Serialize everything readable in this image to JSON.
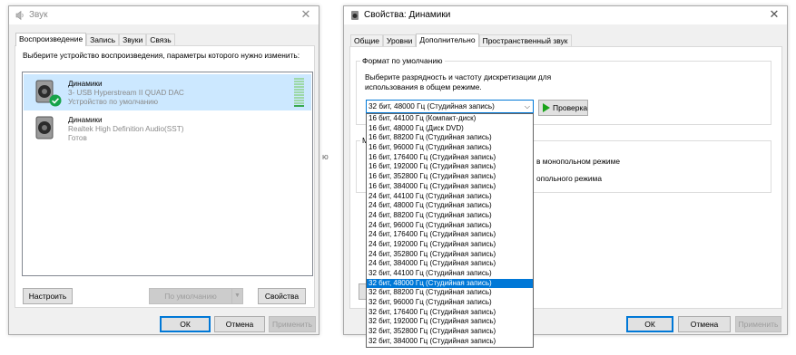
{
  "sound_window": {
    "title": "Звук",
    "tabs": [
      "Воспроизведение",
      "Запись",
      "Звуки",
      "Связь"
    ],
    "active_tab": 0,
    "instruction": "Выберите устройство воспроизведения, параметры которого нужно изменить:",
    "devices": [
      {
        "name": "Динамики",
        "detail": "3- USB Hyperstream II QUAD DAC",
        "status": "Устройство по умолчанию",
        "selected": true,
        "default": true,
        "icon": "speaker-icon"
      },
      {
        "name": "Динамики",
        "detail": "Realtek High Definition Audio(SST)",
        "status": "Готов",
        "selected": false,
        "default": false,
        "icon": "speaker-icon"
      }
    ],
    "configure_label": "Настроить",
    "default_label": "По умолчанию",
    "properties_label": "Свойства",
    "ok_label": "ОК",
    "cancel_label": "Отмена",
    "apply_label": "Применить"
  },
  "props_window": {
    "title": "Свойства: Динамики",
    "tabs": [
      "Общие",
      "Уровни",
      "Дополнительно",
      "Пространственный звук"
    ],
    "active_tab": 2,
    "format_group_label": "Формат по умолчанию",
    "format_description": "Выберите разрядность и частоту дискретизации для использования в общем режиме.",
    "selected_format": "32 бит, 48000 Гц (Студийная запись)",
    "test_label": "Проверка",
    "exclusive_group_letter": "M",
    "exclusive_text_1": "в монопольном режиме",
    "exclusive_text_2": "опольного режима",
    "ok_label": "ОК",
    "cancel_label": "Отмена",
    "apply_label": "Применить",
    "format_options": [
      "16 бит, 44100 Гц (Компакт-диск)",
      "16 бит, 48000 Гц (Диск DVD)",
      "16 бит, 88200 Гц (Студийная запись)",
      "16 бит, 96000 Гц (Студийная запись)",
      "16 бит, 176400 Гц (Студийная запись)",
      "16 бит, 192000 Гц (Студийная запись)",
      "16 бит, 352800 Гц (Студийная запись)",
      "16 бит, 384000 Гц (Студийная запись)",
      "24 бит, 44100 Гц (Студийная запись)",
      "24 бит, 48000 Гц (Студийная запись)",
      "24 бит, 88200 Гц (Студийная запись)",
      "24 бит, 96000 Гц (Студийная запись)",
      "24 бит, 176400 Гц (Студийная запись)",
      "24 бит, 192000 Гц (Студийная запись)",
      "24 бит, 352800 Гц (Студийная запись)",
      "24 бит, 384000 Гц (Студийная запись)",
      "32 бит, 44100 Гц (Студийная запись)",
      "32 бит, 48000 Гц (Студийная запись)",
      "32 бит, 88200 Гц (Студийная запись)",
      "32 бит, 96000 Гц (Студийная запись)",
      "32 бит, 176400 Гц (Студийная запись)",
      "32 бит, 192000 Гц (Студийная запись)",
      "32 бит, 352800 Гц (Студийная запись)",
      "32 бит, 384000 Гц (Студийная запись)"
    ],
    "highlighted_option_index": 17
  },
  "background_fragment": "ю",
  "colors": {
    "accent": "#0078d7",
    "selection": "#cce8ff",
    "default_check": "#16a34a",
    "test_play": "#1aa31a"
  }
}
